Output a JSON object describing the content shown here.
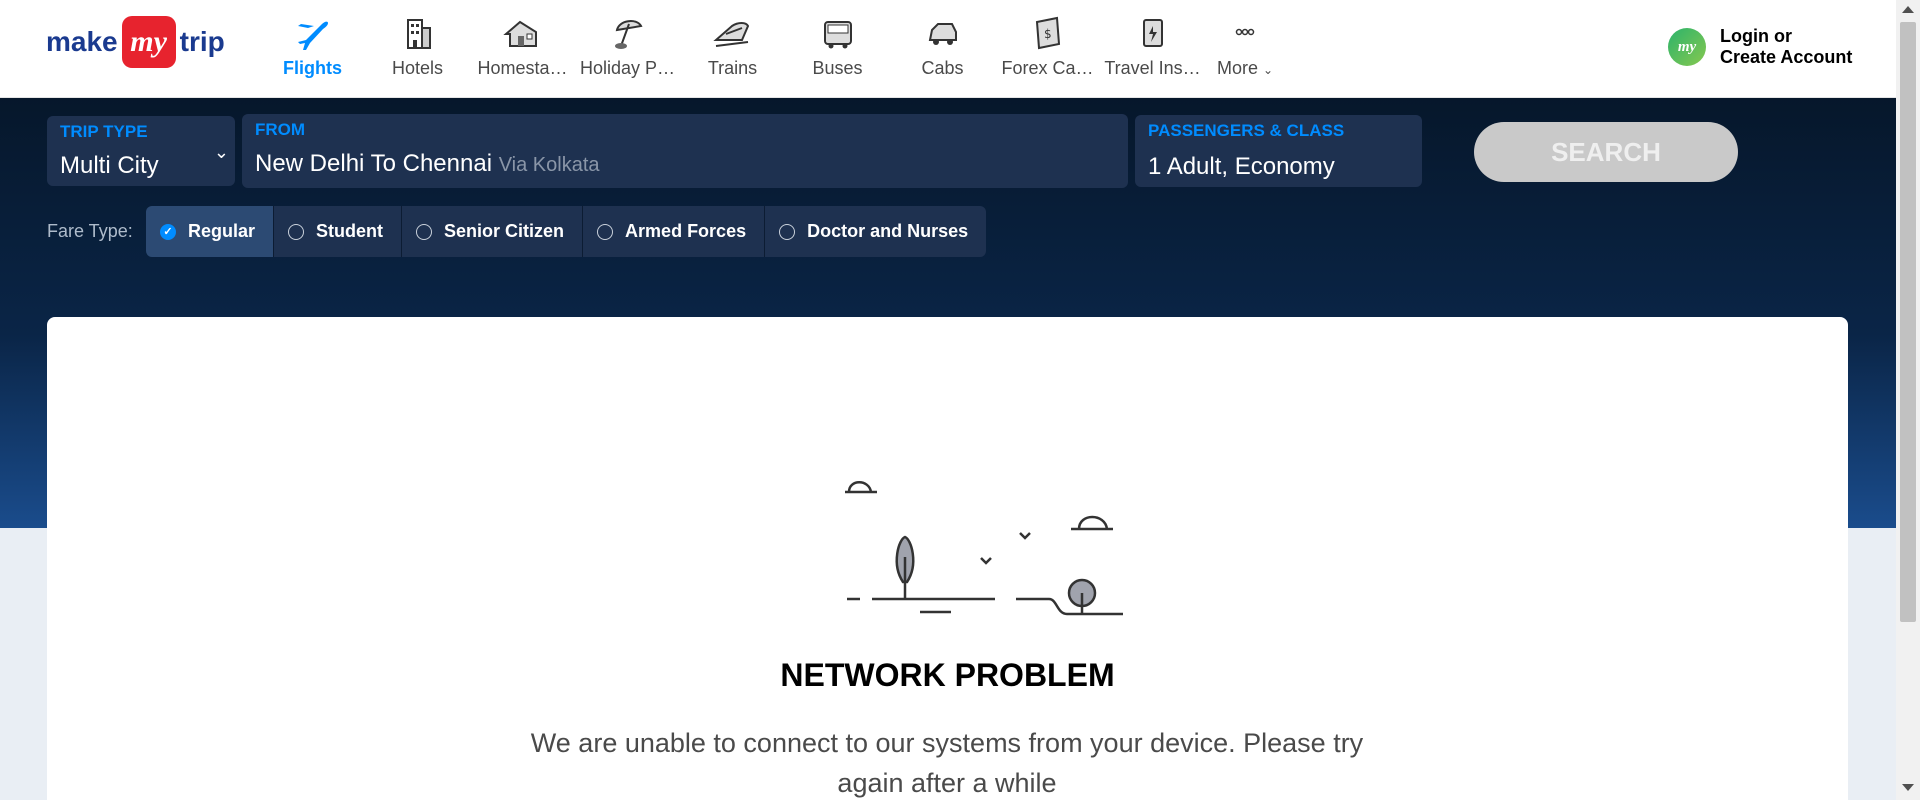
{
  "logo": {
    "make": "make",
    "my": "my",
    "trip": "trip"
  },
  "nav": [
    {
      "label": "Flights",
      "icon": "plane-icon",
      "active": true
    },
    {
      "label": "Hotels",
      "icon": "building-icon"
    },
    {
      "label": "Homesta…",
      "icon": "house-icon"
    },
    {
      "label": "Holiday P…",
      "icon": "umbrella-icon"
    },
    {
      "label": "Trains",
      "icon": "train-icon"
    },
    {
      "label": "Buses",
      "icon": "bus-icon"
    },
    {
      "label": "Cabs",
      "icon": "car-icon"
    },
    {
      "label": "Forex Ca…",
      "icon": "forex-card-icon"
    },
    {
      "label": "Travel Ins…",
      "icon": "insurance-icon"
    }
  ],
  "more": {
    "label": "More",
    "icon": "dots-icon"
  },
  "login": {
    "avatar": "my",
    "line1": "Login or",
    "line2": "Create Account"
  },
  "search": {
    "trip_type": {
      "label": "TRIP TYPE",
      "value": "Multi City"
    },
    "from": {
      "label": "FROM",
      "value": "New Delhi To Chennai",
      "via": "Via Kolkata"
    },
    "passengers": {
      "label": "PASSENGERS & CLASS",
      "value": "1 Adult, Economy"
    },
    "button": "SEARCH"
  },
  "fare": {
    "label": "Fare Type:",
    "options": [
      "Regular",
      "Student",
      "Senior Citizen",
      "Armed Forces",
      "Doctor and Nurses"
    ],
    "selected": "Regular"
  },
  "error": {
    "title": "NETWORK PROBLEM",
    "message": "We are unable to connect to our systems from your device. Please try again after a while"
  },
  "colors": {
    "accent": "#008cff",
    "brand_red": "#e7232e",
    "dark_bg": "#06172b"
  }
}
